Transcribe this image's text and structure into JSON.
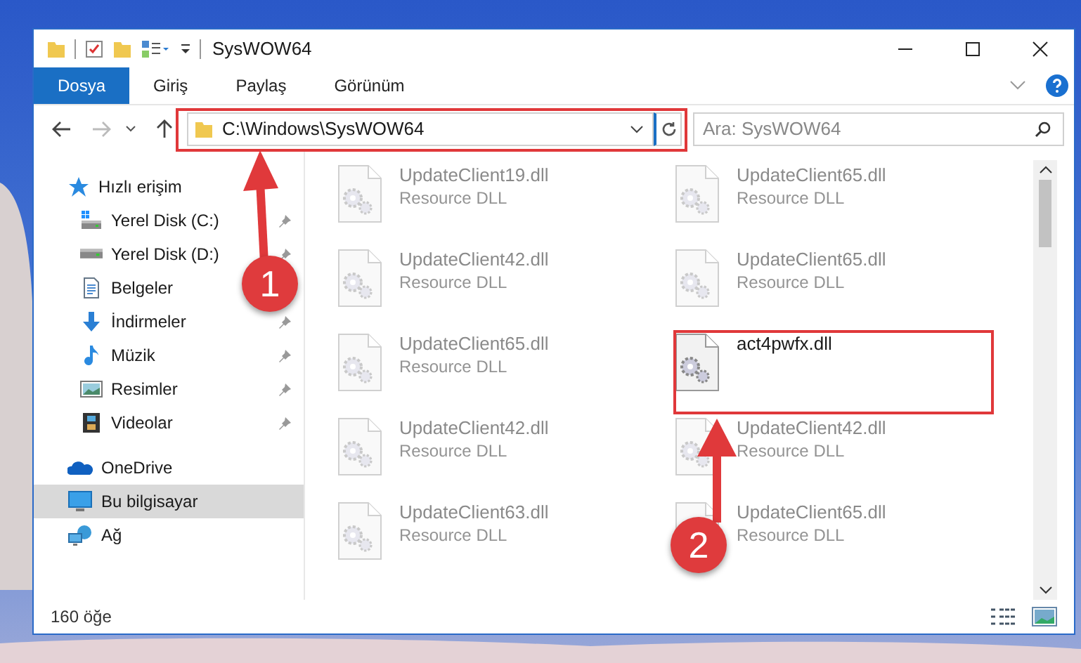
{
  "window": {
    "title": "SysWOW64"
  },
  "ribbon_tabs": [
    {
      "label": "Dosya",
      "selected": true
    },
    {
      "label": "Giriş",
      "selected": false
    },
    {
      "label": "Paylaş",
      "selected": false
    },
    {
      "label": "Görünüm",
      "selected": false
    }
  ],
  "address": {
    "value": "C:\\Windows\\SysWOW64"
  },
  "search": {
    "placeholder": "Ara: SysWOW64"
  },
  "sidebar": {
    "items": [
      {
        "label": "Hızlı erişim",
        "selected": false,
        "children": [
          {
            "label": "Yerel Disk (C:)",
            "pinned": true
          },
          {
            "label": "Yerel Disk (D:)",
            "pinned": true
          },
          {
            "label": "Belgeler",
            "pinned": false
          },
          {
            "label": "İndirmeler",
            "pinned": true
          },
          {
            "label": "Müzik",
            "pinned": true
          },
          {
            "label": "Resimler",
            "pinned": true
          },
          {
            "label": "Videolar",
            "pinned": true
          }
        ]
      },
      {
        "label": "OneDrive",
        "selected": false
      },
      {
        "label": "Bu bilgisayar",
        "selected": true
      },
      {
        "label": "Ağ",
        "selected": false
      }
    ]
  },
  "files": [
    {
      "name": "UpdateClient19.dll",
      "type": "Resource DLL",
      "dimmed": true
    },
    {
      "name": "UpdateClient65.dll",
      "type": "Resource DLL",
      "dimmed": true
    },
    {
      "name": "UpdateClient42.dll",
      "type": "Resource DLL",
      "dimmed": true
    },
    {
      "name": "UpdateClient65.dll",
      "type": "Resource DLL",
      "dimmed": true
    },
    {
      "name": "UpdateClient65.dll",
      "type": "Resource DLL",
      "dimmed": true
    },
    {
      "name": "act4pwfx.dll",
      "dimmed": false
    },
    {
      "name": "UpdateClient42.dll",
      "type": "Resource DLL",
      "dimmed": true
    },
    {
      "name": "UpdateClient42.dll",
      "type": "Resource DLL",
      "dimmed": true
    },
    {
      "name": "UpdateClient63.dll",
      "type": "Resource DLL",
      "dimmed": true
    },
    {
      "name": "UpdateClient65.dll",
      "type": "Resource DLL",
      "dimmed": true
    }
  ],
  "status_bar": {
    "count": "160 öğe"
  },
  "annotations": [
    {
      "label": "1"
    },
    {
      "label": "2"
    }
  ]
}
